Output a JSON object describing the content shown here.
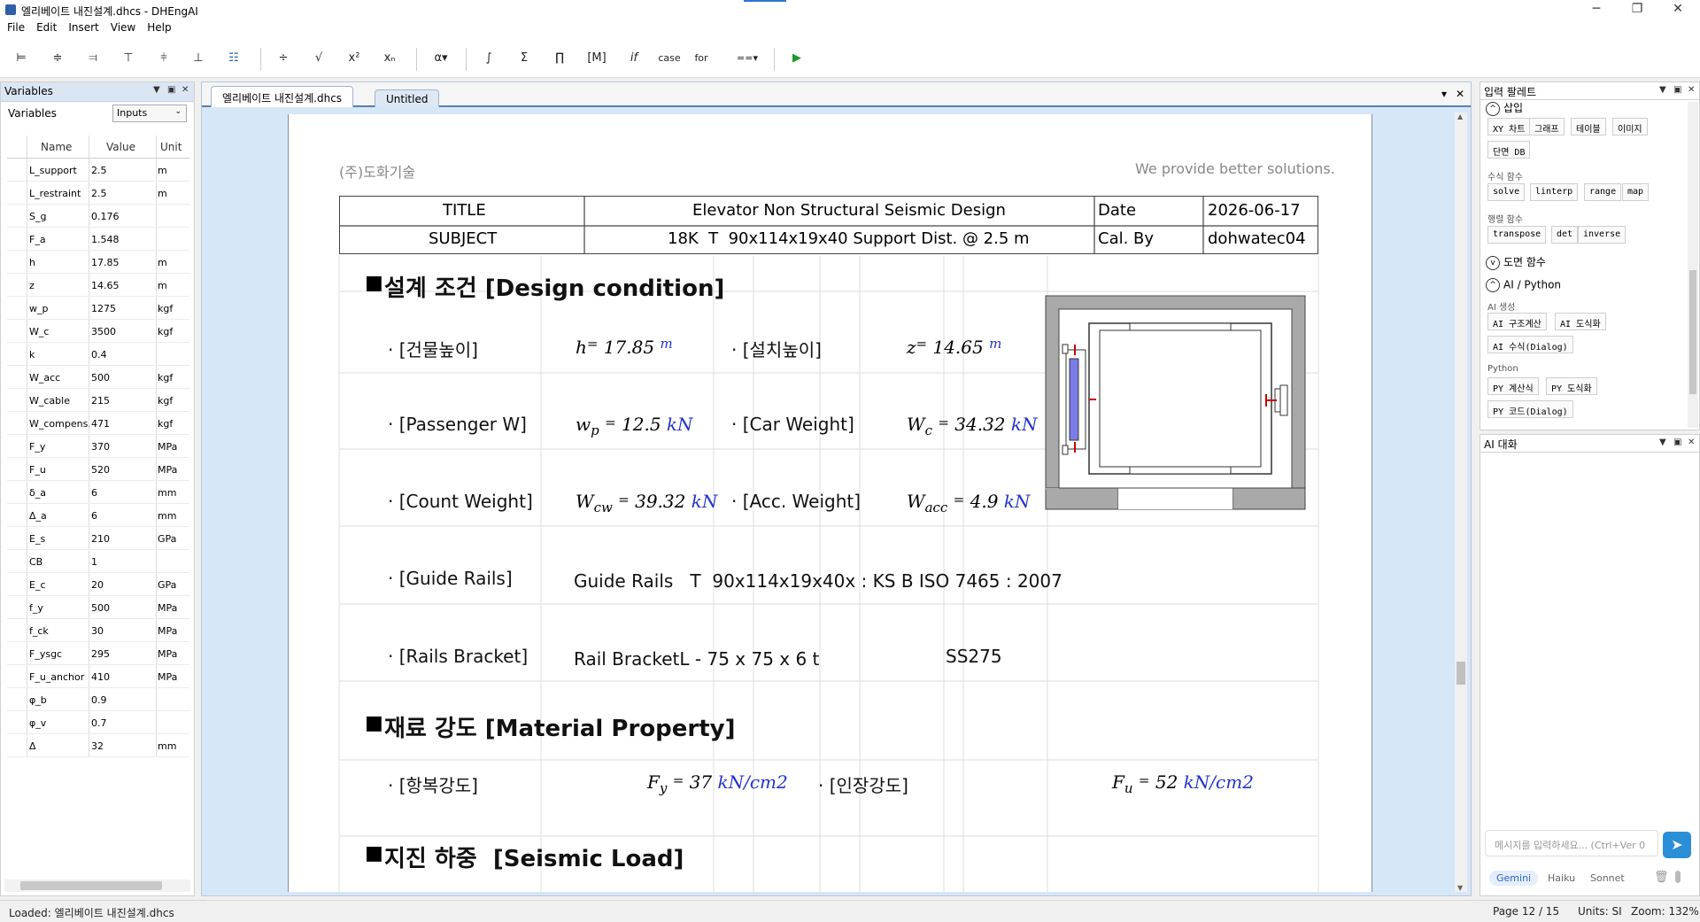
{
  "window": {
    "title": "엘리베이트 내진설계.dhcs - DHEngAI",
    "controls": {
      "minimize": "─",
      "maximize": "❐",
      "close": "✕"
    }
  },
  "menu": [
    "File",
    "Edit",
    "Insert",
    "View",
    "Help"
  ],
  "toolbar": {
    "align": [
      "⊨",
      "≑",
      "⫤",
      "⊤",
      "⫩",
      "⊥",
      "☷"
    ],
    "math": [
      "÷",
      "√",
      "x²",
      "xₙ"
    ],
    "greek": "α▾",
    "calc": [
      "∫",
      "Σ",
      "∏",
      "[M]",
      "if",
      "case",
      "for",
      "==▾"
    ],
    "run": "▶"
  },
  "variables_panel": {
    "title": "Variables",
    "label": "Variables",
    "filter": "Inputs",
    "columns": [
      "Name",
      "Value",
      "Unit"
    ],
    "rows": [
      [
        "L_support",
        "2.5",
        "m"
      ],
      [
        "L_restraint",
        "2.5",
        "m"
      ],
      [
        "S_g",
        "0.176",
        ""
      ],
      [
        "F_a",
        "1.548",
        ""
      ],
      [
        "h",
        "17.85",
        "m"
      ],
      [
        "z",
        "14.65",
        "m"
      ],
      [
        "w_p",
        "1275",
        "kgf"
      ],
      [
        "W_c",
        "3500",
        "kgf"
      ],
      [
        "k",
        "0.4",
        ""
      ],
      [
        "W_acc",
        "500",
        "kgf"
      ],
      [
        "W_cable",
        "215",
        "kgf"
      ],
      [
        "W_compens.",
        "471",
        "kgf"
      ],
      [
        "F_y",
        "370",
        "MPa"
      ],
      [
        "F_u",
        "520",
        "MPa"
      ],
      [
        "δ_a",
        "6",
        "mm"
      ],
      [
        "Δ_a",
        "6",
        "mm"
      ],
      [
        "E_s",
        "210",
        "GPa"
      ],
      [
        "CB",
        "1",
        ""
      ],
      [
        "E_c",
        "20",
        "GPa"
      ],
      [
        "f_y",
        "500",
        "MPa"
      ],
      [
        "f_ck",
        "30",
        "MPa"
      ],
      [
        "F_ysgc",
        "295",
        "MPa"
      ],
      [
        "F_u_anchor",
        "410",
        "MPa"
      ],
      [
        "φ_b",
        "0.9",
        ""
      ],
      [
        "φ_v",
        "0.7",
        ""
      ],
      [
        "Δ",
        "32",
        "mm"
      ]
    ]
  },
  "tabs": [
    {
      "label": "엘리베이트 내진설계.dhcs",
      "active": true
    },
    {
      "label": "Untitled",
      "active": false
    }
  ],
  "document": {
    "company": "(주)도화기술",
    "slogan": "We provide better solutions.",
    "title_table": {
      "title_label": "TITLE",
      "title_value": "Elevator Non Structural Seismic Design",
      "date_label": "Date",
      "date_value": "2026-06-17",
      "subject_label": "SUBJECT",
      "subject_value": "18K  T  90x114x19x40 Support Dist. @ 2.5 m",
      "calby_label": "Cal. By",
      "calby_value": "dohwatec04"
    },
    "section1": "설계 조건 [Design condition]",
    "bullets": {
      "b1": "· [건물높이]",
      "b2": "· [설치높이]",
      "b3": "· [Passenger W]",
      "b4": "· [Car Weight]",
      "b5": "· [Count Weight]",
      "b6": "· [Acc. Weight]",
      "b7": "· [Guide Rails]",
      "b8": "· [Rails Bracket]"
    },
    "eq": {
      "h_var": "h",
      "h_val": "17.85",
      "h_unit": "m",
      "z_var": "z",
      "z_val": "14.65",
      "z_unit": "m",
      "wp_var": "w",
      "wp_sub": "p",
      "wp_val": "12.5",
      "wp_unit": "kN",
      "wc_var": "W",
      "wc_sub": "c",
      "wc_val": "34.32",
      "wc_unit": "kN",
      "wcw_var": "W",
      "wcw_sub": "cw",
      "wcw_val": "39.32",
      "wcw_unit": "kN",
      "wacc_var": "W",
      "wacc_sub": "acc",
      "wacc_val": "4.9",
      "wacc_unit": "kN"
    },
    "guide_rails_text": "Guide Rails   T  90x114x19x40x : KS B ISO 7465 : 2007",
    "rail_bracket_text": "Rail BracketL - 75 x 75 x 6 t",
    "rail_bracket_grade": "SS275",
    "section2": "재료 강도 [Material Property]",
    "mat": {
      "b1": "· [항복강도]",
      "b2": "· [인장강도]",
      "fy_var": "F",
      "fy_sub": "y",
      "fy_val": "37",
      "fy_unit": "kN/cm2",
      "fu_var": "F",
      "fu_sub": "u",
      "fu_val": "52",
      "fu_unit": "kN/cm2"
    },
    "section3": "지진 하중  [Seismic Load]",
    "equals": "="
  },
  "palette": {
    "title": "입력 팔레트",
    "insert_label": "삽입",
    "insert_buttons": [
      "XY 차트",
      "그래프",
      "테이블",
      "이미지",
      "단면 DB"
    ],
    "formula_label": "수식 함수",
    "formula_buttons": [
      "solve",
      "linterp",
      "range",
      "map"
    ],
    "matrix_label": "행렬 함수",
    "matrix_buttons": [
      "transpose",
      "det",
      "inverse"
    ],
    "drawing_section": "도면 함수",
    "ai_section": "AI / Python",
    "ai_gen_label": "AI 생성",
    "ai_buttons": [
      "AI 구조계산",
      "AI 도식화",
      "AI 수식(Dialog)"
    ],
    "python_label": "Python",
    "py_buttons": [
      "PY 계산식",
      "PY 도식화",
      "PY 코드(Dialog)"
    ],
    "collapse_icon": "^",
    "expand_icon": "v"
  },
  "ai_chat": {
    "title": "AI 대화",
    "placeholder": "메시지를 입력하세요... (Ctrl+Ver 0",
    "send": "➤",
    "models": [
      "Gemini",
      "Haiku",
      "Sonnet"
    ]
  },
  "status": {
    "left": "Loaded: 엘리베이트 내진설계.dhcs",
    "page": "Page 12 / 15",
    "units": "Units: SI",
    "zoom": "Zoom: 132%"
  },
  "colors": {
    "unit_blue": "#2233cc",
    "panel_header": "#dbe6f3",
    "doc_bg": "#d6e7f7",
    "accent": "#2b8fd8"
  }
}
